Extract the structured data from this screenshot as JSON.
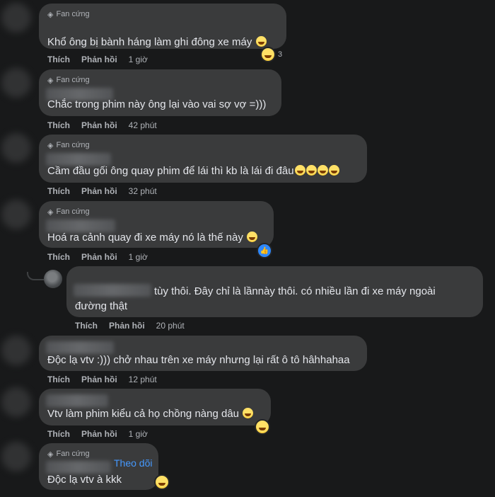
{
  "badge_label": "Fan cứng",
  "action_like": "Thích",
  "action_reply": "Phản hồi",
  "comments": [
    {
      "text": "Khổ ông bị bành háng làm ghi đông xe máy",
      "time": "1 giờ",
      "reaction_count": "3"
    },
    {
      "text": "Chắc trong phim này ông lại vào vai sợ vợ =)))",
      "time": "42 phút"
    },
    {
      "text": "Cầm đầu gối ông quay phim để lái thì kb là lái đi đâu",
      "time": "32 phút"
    },
    {
      "text": "Hoá ra cảnh quay đi xe máy nó là thế này",
      "time": "1 giờ"
    },
    {
      "text_line1": "tùy thôi. Đây chỉ là lầnnày thôi. có nhiều lần đi xe máy ngoài",
      "text_line2": "đường thật",
      "time": "20 phút"
    },
    {
      "text": "Độc lạ vtv :))) chở nhau trên xe máy nhưng lại rất ô tô hâhhahaa",
      "time": "12 phút"
    },
    {
      "text": "Vtv làm phim kiểu cả họ chồng nàng dâu",
      "time": "1 giờ"
    },
    {
      "text": "Độc lạ vtv à kkk",
      "follow_label": "Theo dõi"
    }
  ],
  "icons": {
    "badge": "diamond-icon",
    "reaction": "laughing-emoji-icon",
    "like": "like-icon"
  }
}
